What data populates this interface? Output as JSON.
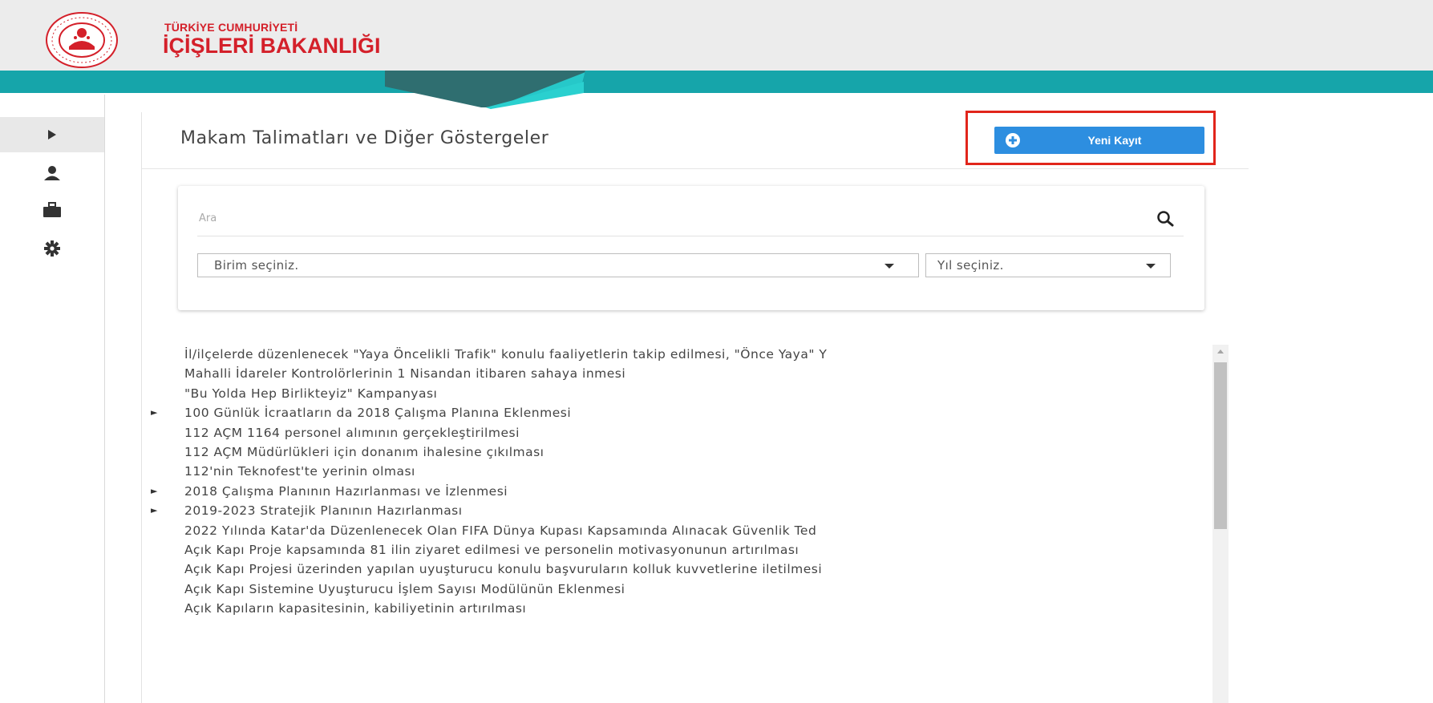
{
  "header": {
    "brand_top": "TÜRKİYE CUMHURİYETİ",
    "brand_main": "İÇİŞLERİ BAKANLIĞI",
    "logo_icon": "ministry-seal-icon"
  },
  "sidebar": {
    "items": [
      {
        "icon": "caret-right-icon",
        "active": true
      },
      {
        "icon": "user-icon",
        "active": false
      },
      {
        "icon": "briefcase-icon",
        "active": false
      },
      {
        "icon": "gear-icon",
        "active": false
      }
    ]
  },
  "page": {
    "title": "Makam Talimatları ve Diğer Göstergeler",
    "new_button_label": "Yeni Kayıt",
    "new_button_icon": "plus-circle-icon"
  },
  "filter": {
    "search_placeholder": "Ara",
    "unit_select": "Birim seçiniz.",
    "year_select": "Yıl seçiniz."
  },
  "list": {
    "items": [
      {
        "text": "İl/ilçelerde düzenlenecek \"Yaya Öncelikli Trafik\" konulu faaliyetlerin takip edilmesi, \"Önce Yaya\" Y",
        "expandable": false
      },
      {
        "text": "Mahalli İdareler Kontrolörlerinin 1 Nisandan itibaren sahaya inmesi",
        "expandable": false
      },
      {
        "text": "\"Bu Yolda Hep Birlikteyiz\" Kampanyası",
        "expandable": false
      },
      {
        "text": "100 Günlük İcraatların da 2018 Çalışma Planına Eklenmesi",
        "expandable": true
      },
      {
        "text": "112 AÇM 1164 personel alımının gerçekleştirilmesi",
        "expandable": false
      },
      {
        "text": "112 AÇM Müdürlükleri için donanım ihalesine çıkılması",
        "expandable": false
      },
      {
        "text": "112'nin Teknofest'te yerinin olması",
        "expandable": false
      },
      {
        "text": "2018 Çalışma Planının Hazırlanması ve İzlenmesi",
        "expandable": true
      },
      {
        "text": "2019-2023 Stratejik Planının Hazırlanması",
        "expandable": true
      },
      {
        "text": "2022 Yılında Katar'da Düzenlenecek Olan FIFA Dünya Kupası Kapsamında Alınacak Güvenlik Ted",
        "expandable": false
      },
      {
        "text": "Açık Kapı Proje kapsamında 81 ilin ziyaret edilmesi ve personelin motivasyonunun artırılması",
        "expandable": false
      },
      {
        "text": "Açık Kapı Projesi üzerinden yapılan uyuşturucu konulu başvuruların kolluk kuvvetlerine iletilmesi",
        "expandable": false
      },
      {
        "text": "Açık Kapı Sistemine Uyuşturucu İşlem Sayısı Modülünün Eklenmesi",
        "expandable": false
      },
      {
        "text": "Açık Kapıların kapasitesinin, kabiliyetinin artırılması",
        "expandable": false
      }
    ],
    "expand_glyph": "►"
  },
  "colors": {
    "brand_red": "#d4202a",
    "teal": "#16a5aa",
    "teal_light": "#26c8c9",
    "teal_dark": "#2f6e70",
    "button_blue": "#2d8ee0",
    "highlight_red": "#e1251b"
  }
}
